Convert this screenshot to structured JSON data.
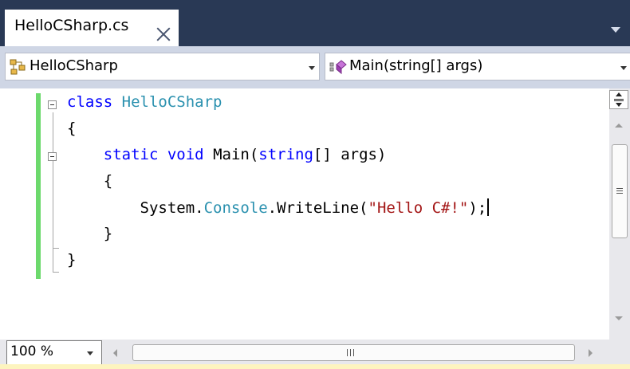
{
  "tab": {
    "title": "HelloCSharp.cs"
  },
  "navigation": {
    "type_combo": "HelloCSharp",
    "member_combo": "Main(string[] args)"
  },
  "code_lines": [
    {
      "tokens": [
        {
          "t": "class",
          "c": "kw"
        },
        {
          "t": " "
        },
        {
          "t": "HelloCSharp",
          "c": "ty"
        }
      ]
    },
    {
      "tokens": [
        {
          "t": "{"
        }
      ]
    },
    {
      "tokens": [
        {
          "t": "    "
        },
        {
          "t": "static",
          "c": "kw"
        },
        {
          "t": " "
        },
        {
          "t": "void",
          "c": "kw"
        },
        {
          "t": " Main("
        },
        {
          "t": "string",
          "c": "kw"
        },
        {
          "t": "[] args)"
        }
      ]
    },
    {
      "tokens": [
        {
          "t": "    {"
        }
      ]
    },
    {
      "tokens": [
        {
          "t": "        System."
        },
        {
          "t": "Console",
          "c": "ty"
        },
        {
          "t": ".WriteLine("
        },
        {
          "t": "\"Hello C#!\"",
          "c": "str"
        },
        {
          "t": ");"
        }
      ],
      "caret": true
    },
    {
      "tokens": [
        {
          "t": "    }"
        }
      ]
    },
    {
      "tokens": [
        {
          "t": "}"
        }
      ]
    }
  ],
  "colors": {
    "keyword": "#0000ff",
    "type": "#2b91af",
    "string": "#a31515",
    "change_bar": "#6cd96c",
    "tabstrip": "#293955"
  },
  "zoom": {
    "value": "100 %"
  },
  "icons": {
    "type_combo_icon": "class-icon",
    "member_combo_icon": "method-icon"
  }
}
